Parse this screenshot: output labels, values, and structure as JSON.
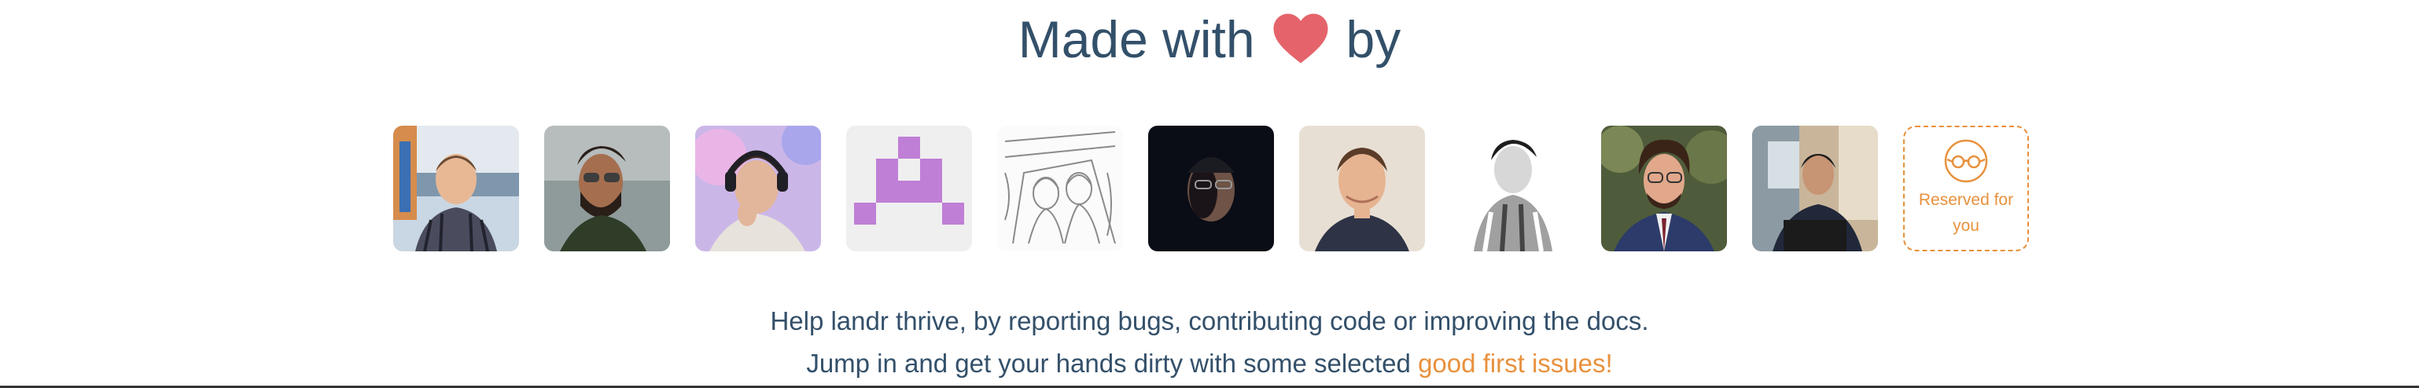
{
  "heading": {
    "before": "Made with",
    "heart_icon": "heart-icon",
    "after": "by"
  },
  "contributors": [
    {
      "alt": "contributor-avatar-1"
    },
    {
      "alt": "contributor-avatar-2"
    },
    {
      "alt": "contributor-avatar-3"
    },
    {
      "alt": "contributor-avatar-4"
    },
    {
      "alt": "contributor-avatar-5"
    },
    {
      "alt": "contributor-avatar-6"
    },
    {
      "alt": "contributor-avatar-7"
    },
    {
      "alt": "contributor-avatar-8"
    },
    {
      "alt": "contributor-avatar-9"
    },
    {
      "alt": "contributor-avatar-10"
    }
  ],
  "reserved": {
    "icon": "glasses-icon",
    "label": "Reserved for you"
  },
  "description": {
    "line1": "Help landr thrive, by reporting bugs, contributing code or improving the docs.",
    "line2_prefix": "Jump in and get your hands dirty with some selected ",
    "line2_link": "good first issues!"
  },
  "colors": {
    "text": "#33506a",
    "accent": "#e8913d",
    "heart": "#e5646b",
    "identicon": "#bf7fd6"
  }
}
